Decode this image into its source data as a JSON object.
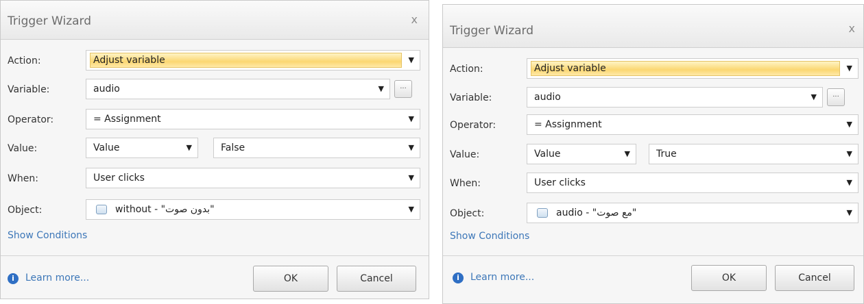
{
  "dialogs": [
    {
      "title": "Trigger Wizard",
      "close": "x",
      "fields": {
        "action_label": "Action:",
        "action_value": "Adjust variable",
        "variable_label": "Variable:",
        "variable_value": "audio",
        "more_button": "...",
        "operator_label": "Operator:",
        "operator_value": "= Assignment",
        "value_label": "Value:",
        "value_type": "Value",
        "value_value": "False",
        "when_label": "When:",
        "when_value": "User clicks",
        "object_label": "Object:",
        "object_value": "without - \"بدون صوت\""
      },
      "show_conditions": "Show Conditions",
      "learn_more": "Learn more...",
      "ok": "OK",
      "cancel": "Cancel"
    },
    {
      "title": "Trigger Wizard",
      "close": "x",
      "fields": {
        "action_label": "Action:",
        "action_value": "Adjust variable",
        "variable_label": "Variable:",
        "variable_value": "audio",
        "more_button": "...",
        "operator_label": "Operator:",
        "operator_value": "= Assignment",
        "value_label": "Value:",
        "value_type": "Value",
        "value_value": "True",
        "when_label": "When:",
        "when_value": "User clicks",
        "object_label": "Object:",
        "object_value": "audio - \"مع صوت\""
      },
      "show_conditions": "Show Conditions",
      "learn_more": "Learn more...",
      "ok": "OK",
      "cancel": "Cancel"
    }
  ],
  "icons": {
    "info": "info-icon",
    "object": "button-object-icon",
    "dropdown": "chevron-down-icon",
    "close": "close-icon"
  }
}
